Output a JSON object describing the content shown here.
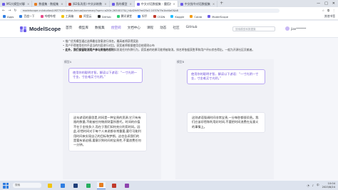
{
  "browser": {
    "tabs": [
      {
        "label": "MS大模型对聊",
        "color": "#6c5ce7",
        "active": false
      },
      {
        "label": "数据集 · 数据集",
        "color": "#e67e22",
        "active": false
      },
      {
        "label": "(82条消息) 中文训练数据",
        "color": "#c0392b",
        "active": false
      },
      {
        "label": "我的模型",
        "color": "#6c5ce7",
        "active": false
      },
      {
        "label": "中文对话数据集 - 魔搭社区",
        "color": "#6c5ce7",
        "active": true
      },
      {
        "label": "中文指令对话数据集",
        "color": "#6c5ce7",
        "active": false
      }
    ],
    "new_tab": "+",
    "window_controls": [
      "—",
      "□",
      "✕"
    ],
    "url": "modelscope.cn/studios/LMZ7G/Chinese-Annual/summary?spm=a2l0k.2634017&l_h&d2fd97ed25a2.1037b7fa1bd4a0&b8",
    "bookmarks": [
      {
        "label": "Apps",
        "color": "#2f7de1"
      },
      {
        "label": "百度一下",
        "color": "#2f7de1"
      },
      {
        "label": "哔哩哔哩",
        "color": "#e74c8b"
      },
      {
        "label": "工具箱",
        "color": "#f1c40f"
      },
      {
        "label": "阿里云",
        "color": "#e67e22"
      },
      {
        "label": "GitHub",
        "color": "#333333"
      },
      {
        "label": "腾讯课堂",
        "color": "#2ecc71"
      },
      {
        "label": "知乎",
        "color": "#1e80ff"
      },
      {
        "label": "CSDN",
        "color": "#c0392b"
      },
      {
        "label": "Kaggle",
        "color": "#20beff"
      },
      {
        "label": "Colab",
        "color": "#f39c12"
      },
      {
        "label": "ModelScope",
        "color": "#6c5ce7"
      }
    ],
    "bookmarks_right": "其他书签"
  },
  "site": {
    "logo_text": "ModelScope",
    "nav": [
      {
        "label": "首页",
        "active": false
      },
      {
        "label": "模型库",
        "active": false
      },
      {
        "label": "数据集",
        "active": false
      },
      {
        "label": "创空间",
        "active": true
      },
      {
        "label": "文档中心",
        "active": false
      },
      {
        "label": "课程",
        "active": false
      },
      {
        "label": "动态",
        "active": false
      },
      {
        "label": "社区",
        "active": false
      },
      {
        "label": "GitHub",
        "active": false
      }
    ],
    "search_placeholder": "搜索模型和数据集",
    "user": "jian*******"
  },
  "description": {
    "line1": "推广优秀模型通过选择最佳答案进行排名，最高者将获得奖励",
    "line2": "用户不得使用任何不适当的内容进行对比，获奖者将根据使用总结规则公布",
    "line3_bold": "此外，我们保留取消用户参与资格的权利",
    "line3": "如发现任何作弊行为，获奖者的结果可能将被取消。排名将依据获胜率和用户评价综合得出，一般为开源社区贡献者。"
  },
  "panels": {
    "left": {
      "label": "模型A",
      "question": "使用你的聪明才智，解读以下谚语：“一寸光阴一寸金，寸金难买寸光阴。”",
      "answer": "这句谚语的意思是,时间是一种宝贵的资源,它只有有限的数量,不能被任何物质财富所替代。时间的价值不在于金钱多少,而在于我们如何充分利用时间。因此,珍惜时间对于每个人来说都非常重要,要尽可能利用时间来实现自己的目标和梦想。这也告诉我们的是要有紧迫感,要意识到时间的宝贵性,不要浪费任何一分钟。"
    },
    "right": {
      "label": "模型B",
      "question": "使用你的聪明才智，解读以下谚语：“一寸光阴一寸金，寸金难买寸光阴。”",
      "answer": "这则谚语强调时间非常宝贵,一分每秒都很珍贵。我们应该珍惜和利用好时间,不要把时间浪费在无意义的事情上。"
    }
  },
  "taskbar": {
    "search_text": "搜索",
    "apps": [
      {
        "label": "",
        "color": "#f1c40f",
        "active": false
      },
      {
        "label": "",
        "color": "#2f7de1",
        "active": false
      },
      {
        "label": "",
        "color": "#1f3e7a",
        "active": false
      },
      {
        "label": "",
        "color": "#27ae60",
        "active": false
      },
      {
        "label": "",
        "color": "#e67e22",
        "active": true
      },
      {
        "label": "",
        "color": "#c0392b",
        "active": false
      },
      {
        "label": "",
        "color": "#8e44ad",
        "active": false
      }
    ],
    "tray_text": "中",
    "time": "10:04",
    "date": "2023/8/24"
  }
}
